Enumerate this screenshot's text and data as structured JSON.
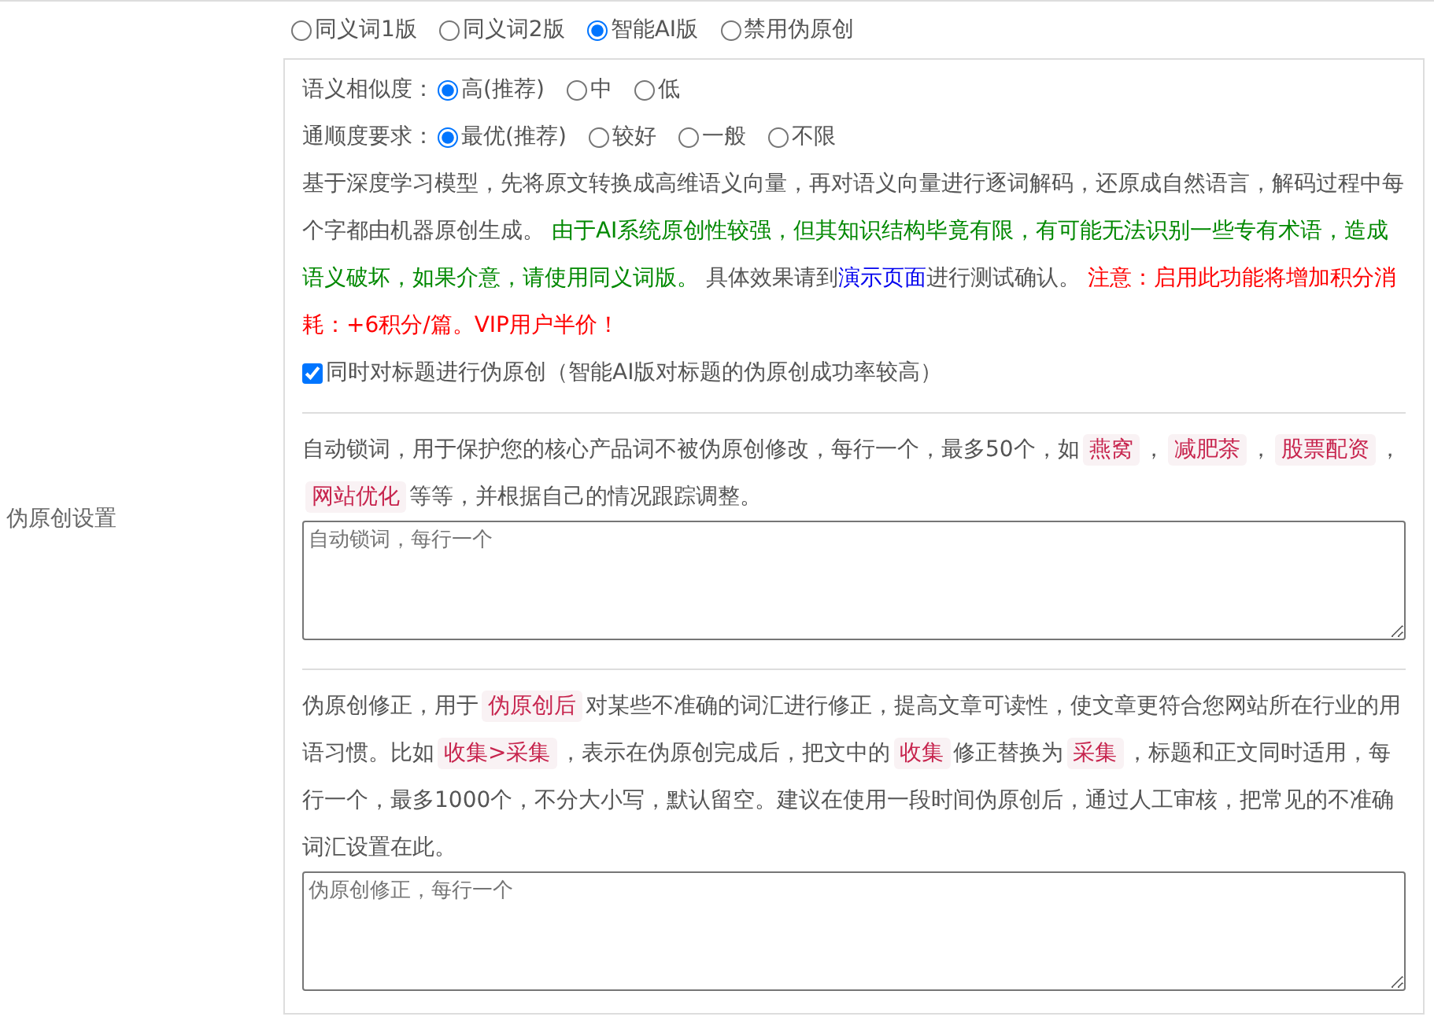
{
  "section_label": "伪原创设置",
  "modes": [
    {
      "label": "同义词1版",
      "selected": false
    },
    {
      "label": "同义词2版",
      "selected": false
    },
    {
      "label": "智能AI版",
      "selected": true
    },
    {
      "label": "禁用伪原创",
      "selected": false
    }
  ],
  "similarity": {
    "label": "语义相似度：",
    "options": [
      {
        "label": "高(推荐)",
        "selected": true
      },
      {
        "label": "中",
        "selected": false
      },
      {
        "label": "低",
        "selected": false
      }
    ]
  },
  "fluency": {
    "label": "通顺度要求：",
    "options": [
      {
        "label": "最优(推荐)",
        "selected": true
      },
      {
        "label": "较好",
        "selected": false
      },
      {
        "label": "一般",
        "selected": false
      },
      {
        "label": "不限",
        "selected": false
      }
    ]
  },
  "description": [
    {
      "kind": "plain",
      "text": "基于深度学习模型，先将原文转换成高维语义向量，再对语义向量进行逐词解码，还原成自然语言，解码过程中每个字都由机器原创生成。 "
    },
    {
      "kind": "green",
      "text": "由于AI系统原创性较强，但其知识结构毕竟有限，有可能无法识别一些专有术语，造成语义破坏，如果介意，请使用同义词版。"
    },
    {
      "kind": "plain",
      "text": " 具体效果请到"
    },
    {
      "kind": "link",
      "text": "演示页面"
    },
    {
      "kind": "plain",
      "text": "进行测试确认。 "
    },
    {
      "kind": "red",
      "text": "注意：启用此功能将增加积分消耗：+6积分/篇。VIP用户半价！"
    }
  ],
  "title_option": {
    "label": "同时对标题进行伪原创（智能AI版对标题的伪原创成功率较高）",
    "checked": true
  },
  "lock_words": {
    "description": [
      {
        "kind": "plain",
        "text": "自动锁词，用于保护您的核心产品词不被伪原创修改，每行一个，最多50个，如"
      },
      {
        "kind": "tag",
        "text": "燕窝"
      },
      {
        "kind": "plain",
        "text": "，"
      },
      {
        "kind": "tag",
        "text": "减肥茶"
      },
      {
        "kind": "plain",
        "text": "，"
      },
      {
        "kind": "tag",
        "text": "股票配资"
      },
      {
        "kind": "plain",
        "text": "，"
      },
      {
        "kind": "tag",
        "text": "网站优化"
      },
      {
        "kind": "plain",
        "text": "等等，并根据自己的情况跟踪调整。"
      }
    ],
    "placeholder": "自动锁词，每行一个"
  },
  "corrections": {
    "description": [
      {
        "kind": "plain",
        "text": "伪原创修正，用于"
      },
      {
        "kind": "tag",
        "text": "伪原创后"
      },
      {
        "kind": "plain",
        "text": "对某些不准确的词汇进行修正，提高文章可读性，使文章更符合您网站所在行业的用语习惯。比如"
      },
      {
        "kind": "tag",
        "text": "收集>采集"
      },
      {
        "kind": "plain",
        "text": "，表示在伪原创完成后，把文中的"
      },
      {
        "kind": "tag",
        "text": "收集"
      },
      {
        "kind": "plain",
        "text": "修正替换为"
      },
      {
        "kind": "tag",
        "text": "采集"
      },
      {
        "kind": "plain",
        "text": "，标题和正文同时适用，每行一个，最多1000个，不分大小写，默认留空。建议在使用一段时间伪原创后，通过人工审核，把常见的不准确词汇设置在此。"
      }
    ],
    "placeholder": "伪原创修正，每行一个"
  }
}
